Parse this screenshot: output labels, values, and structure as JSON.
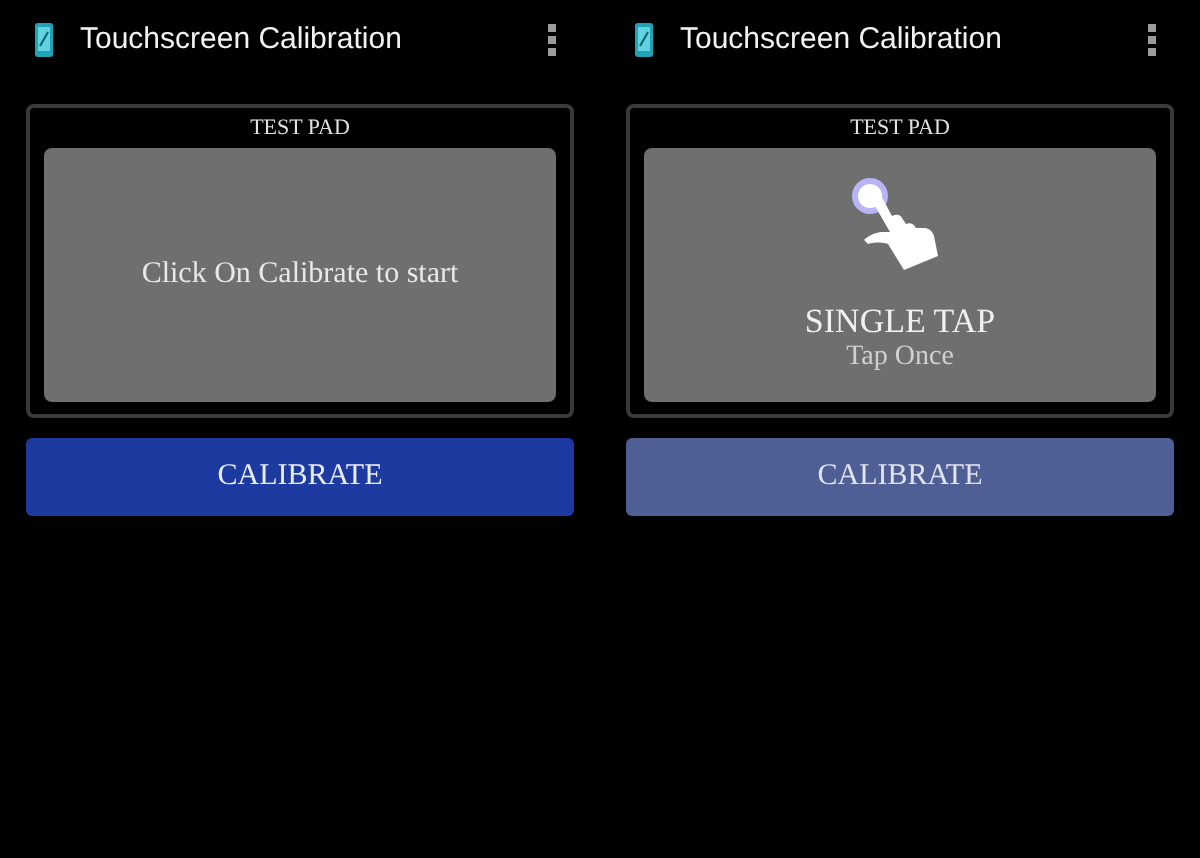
{
  "screens": [
    {
      "title": "Touchscreen Calibration",
      "test_pad": {
        "label": "TEST PAD",
        "kind": "message",
        "message": "Click On Calibrate to start"
      },
      "calibrate_button": {
        "label": "CALIBRATE",
        "disabled": false
      }
    },
    {
      "title": "Touchscreen Calibration",
      "test_pad": {
        "label": "TEST PAD",
        "kind": "gesture",
        "gesture": "SINGLE TAP",
        "instruction": "Tap Once"
      },
      "calibrate_button": {
        "label": "CALIBRATE",
        "disabled": true
      }
    }
  ]
}
